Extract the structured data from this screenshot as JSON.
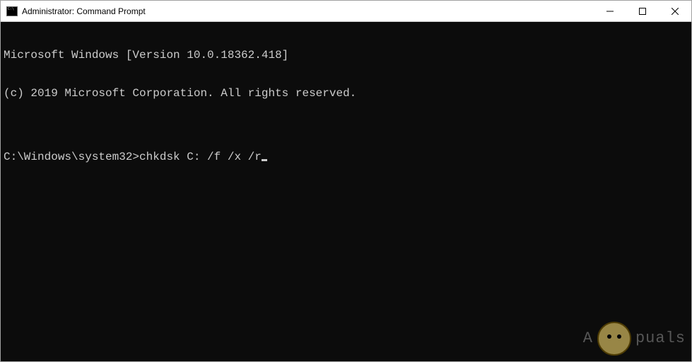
{
  "window": {
    "title": "Administrator: Command Prompt"
  },
  "terminal": {
    "line1": "Microsoft Windows [Version 10.0.18362.418]",
    "line2": "(c) 2019 Microsoft Corporation. All rights reserved.",
    "blank": "",
    "prompt": "C:\\Windows\\system32>",
    "command": "chkdsk C: /f /x /r"
  },
  "watermark": {
    "text_left": "A",
    "text_right": "puals"
  }
}
